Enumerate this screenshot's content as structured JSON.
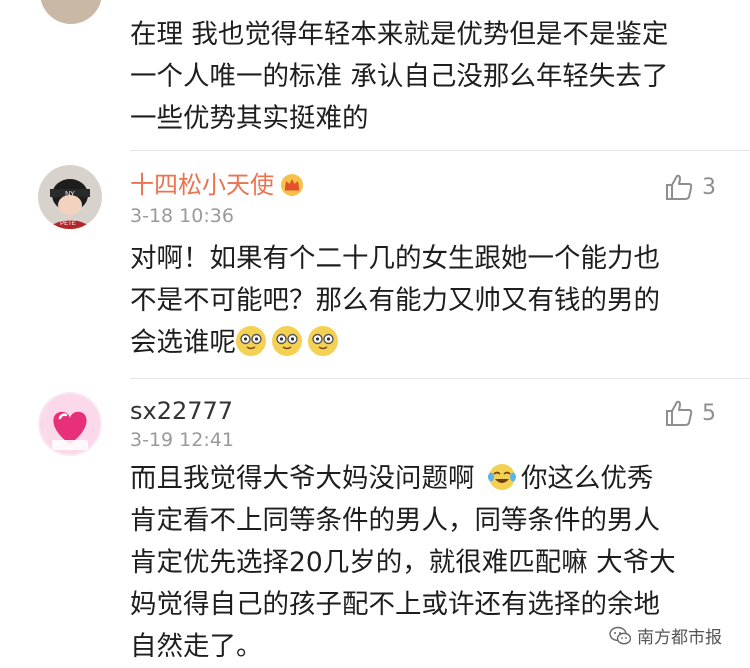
{
  "top_comment": {
    "lines": [
      "在理 我也觉得年轻本来就是优势但是不是鉴定",
      "一个人唯一的标准 承认自己没那么年轻失去了",
      "一些优势其实挺难的"
    ]
  },
  "comments": [
    {
      "username": "十四松小天使",
      "timestamp": "3-18 10:36",
      "likes": "3",
      "lines": [
        "对啊！如果有个二十几的女生跟她一个能力也",
        "不是不可能吧？那么有能力又帅又有钱的男的",
        "会选谁呢"
      ],
      "emoji": [
        "laugh-cry-face-icon",
        "laugh-cry-face-icon",
        "laugh-cry-face-icon"
      ]
    },
    {
      "username": "sx22777",
      "timestamp": "3-19 12:41",
      "likes": "5",
      "lines": [
        "而且我觉得大爷大妈没问题啊",
        "你这么优秀",
        "肯定看不上同等条件的男人，同等条件的男人",
        "肯定优先选择20几岁的，就很难匹配嘛 大爷大",
        "妈觉得自己的孩子配不上或许还有选择的余地",
        "自然走了。"
      ]
    }
  ],
  "watermark": "南方都市报",
  "colors": {
    "vip_name": "#eb7350",
    "meta_gray": "#9a9a9a",
    "divider": "#e6e6e6"
  }
}
